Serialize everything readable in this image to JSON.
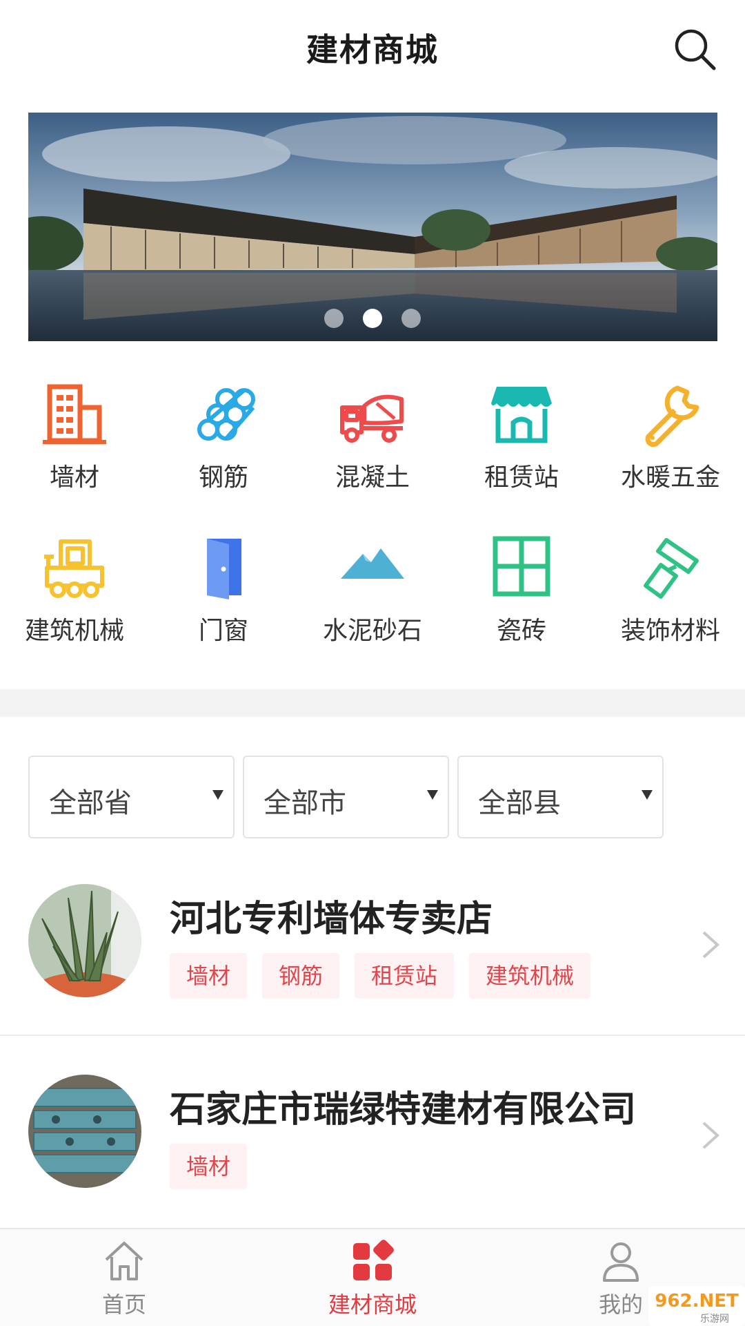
{
  "header": {
    "title": "建材商城",
    "search_icon": "search-icon"
  },
  "banner": {
    "slide_count": 3,
    "active_index": 1
  },
  "categories": [
    {
      "label": "墙材",
      "icon": "building-icon",
      "color": "#f0622f"
    },
    {
      "label": "钢筋",
      "icon": "steel-bars-icon",
      "color": "#29a9e6"
    },
    {
      "label": "混凝土",
      "icon": "concrete-mixer-truck-icon",
      "color": "#ef4b4b"
    },
    {
      "label": "租赁站",
      "icon": "storefront-icon",
      "color": "#19b8b0"
    },
    {
      "label": "水暖五金",
      "icon": "wrench-icon",
      "color": "#f5b12b"
    },
    {
      "label": "建筑机械",
      "icon": "forklift-icon",
      "color": "#f7c22e"
    },
    {
      "label": "门窗",
      "icon": "door-icon",
      "color": "#3e74e8"
    },
    {
      "label": "水泥砂石",
      "icon": "mountain-icon",
      "color": "#4fb0d6"
    },
    {
      "label": "瓷砖",
      "icon": "tile-grid-icon",
      "color": "#2fc286"
    },
    {
      "label": "装饰材料",
      "icon": "paint-roller-icon",
      "color": "#2fc286"
    }
  ],
  "filters": [
    {
      "label": "全部省"
    },
    {
      "label": "全部市"
    },
    {
      "label": "全部县"
    }
  ],
  "stores": [
    {
      "name": "河北专利墙体专卖店",
      "tags": [
        "墙材",
        "钢筋",
        "租赁站",
        "建筑机械"
      ]
    },
    {
      "name": "石家庄市瑞绿特建材有限公司",
      "tags": [
        "墙材"
      ]
    }
  ],
  "bottom_nav": [
    {
      "label": "首页",
      "icon": "home-icon",
      "active": false
    },
    {
      "label": "建材商城",
      "icon": "mall-grid-icon",
      "active": true
    },
    {
      "label": "我的",
      "icon": "user-icon",
      "active": false
    }
  ],
  "colors": {
    "accent": "#e23a3f",
    "tag_bg": "#fdf1f1",
    "tag_text": "#e0464b"
  },
  "watermark": {
    "text": "962.NET",
    "subtext": "乐游网"
  }
}
